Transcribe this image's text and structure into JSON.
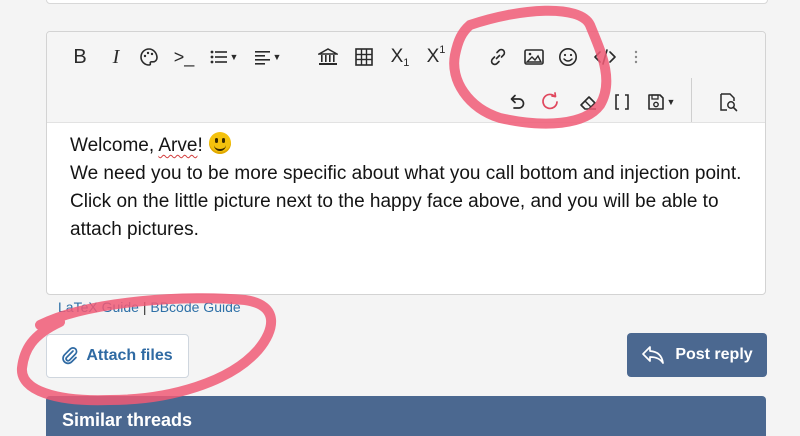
{
  "colors": {
    "accent": "#4b6890",
    "link": "#2f71a8",
    "annotation": "#f05a75"
  },
  "toolbar": {
    "bold_label": "B",
    "italic_label": "I",
    "subscript_label": "X",
    "subscript_sub": "1",
    "superscript_label": "X",
    "superscript_sup": "1",
    "code_label": ">_",
    "icons": [
      "palette-icon",
      "list-icon",
      "align-icon",
      "institution-icon",
      "table-icon",
      "link-icon",
      "image-icon",
      "emoji-icon",
      "code-icon",
      "more-icon",
      "undo-icon",
      "redo-icon",
      "eraser-icon",
      "brackets-icon",
      "save-draft-icon",
      "preview-icon"
    ]
  },
  "editor": {
    "line1_prefix": "Welcome, ",
    "line1_name": "Arve",
    "line1_suffix": "!",
    "paragraph2": "We need you to be more specific about what you call bottom and injection point.",
    "paragraph3": "Click on the little picture next to the happy face above, and you will be able to attach pictures."
  },
  "guides": {
    "latex": "LaTeX Guide",
    "separator": "|",
    "bbcode": "BBcode Guide"
  },
  "buttons": {
    "attach_files": "Attach files",
    "post_reply": "Post reply"
  },
  "section": {
    "similar_threads": "Similar threads"
  }
}
